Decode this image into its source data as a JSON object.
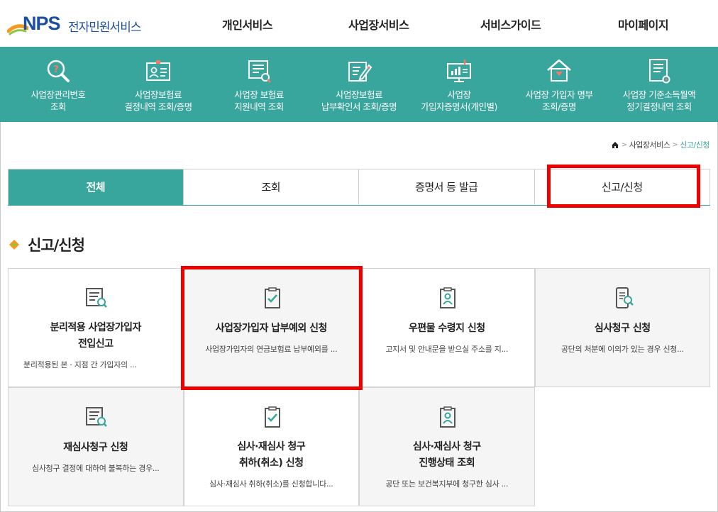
{
  "header": {
    "logo_brand": "NPS",
    "logo_text": "전자민원서비스",
    "nav": [
      "개인서비스",
      "사업장서비스",
      "서비스가이드",
      "마이페이지"
    ]
  },
  "quick_menu": [
    {
      "line1": "사업장관리번호",
      "line2": "조회",
      "icon": "search-magnifier-icon"
    },
    {
      "line1": "사업장보험료",
      "line2": "결정내역 조회/증명",
      "icon": "id-card-icon"
    },
    {
      "line1": "사업장 보험료",
      "line2": "지원내역 조회",
      "icon": "document-search-icon"
    },
    {
      "line1": "사업장보험료",
      "line2": "납부확인서 조회/증명",
      "icon": "document-edit-icon"
    },
    {
      "line1": "사업장",
      "line2": "가입자증명서(개인별)",
      "icon": "monitor-chart-icon"
    },
    {
      "line1": "사업장 가입자 명부",
      "line2": "조회/증명",
      "icon": "house-icon"
    },
    {
      "line1": "사업장 기준소득월액",
      "line2": "정기결정내역 조회",
      "icon": "document-list-icon"
    }
  ],
  "breadcrumb": {
    "home_icon": "home-icon",
    "items": [
      "사업장서비스",
      "신고/신청"
    ]
  },
  "tabs": [
    {
      "label": "전체",
      "active": true
    },
    {
      "label": "조회",
      "active": false
    },
    {
      "label": "증명서 등 발급",
      "active": false
    },
    {
      "label": "신고/신청",
      "active": false
    }
  ],
  "section": {
    "title": "신고/신청"
  },
  "cards": [
    {
      "title1": "분리적용 사업장가입자",
      "title2": "전입신고",
      "desc": "분리적용된 본 · 지점 간 가입자의 ...",
      "icon": "document-search-icon"
    },
    {
      "title1": "사업장가입자 납부예외 신청",
      "title2": "",
      "desc": "사업장가입자의 연금보험료 납부예외를 ...",
      "icon": "clipboard-check-icon"
    },
    {
      "title1": "우편물 수령지 신청",
      "title2": "",
      "desc": "고지서 및 안내문을 받으실 주소를 지...",
      "icon": "clipboard-person-icon"
    },
    {
      "title1": "심사청구 신청",
      "title2": "",
      "desc": "공단의 처분에 이의가 있는 경우 신청...",
      "icon": "mobile-search-icon"
    },
    {
      "title1": "재심사청구 신청",
      "title2": "",
      "desc": "심사청구 결정에 대하여 불복하는 경우...",
      "icon": "document-search-icon"
    },
    {
      "title1": "심사·재심사 청구",
      "title2": "취하(취소) 신청",
      "desc": "심사·재심사 취하(취소)를 신청합니다...",
      "icon": "clipboard-check-icon"
    },
    {
      "title1": "심사·재심사 청구",
      "title2": "진행상태 조회",
      "desc": "공단 또는 보건복지부에 청구한 심사 ...",
      "icon": "clipboard-person-icon"
    }
  ],
  "colors": {
    "accent": "#38a69c",
    "highlight": "#ef0000",
    "brand": "#1d4fa0"
  }
}
